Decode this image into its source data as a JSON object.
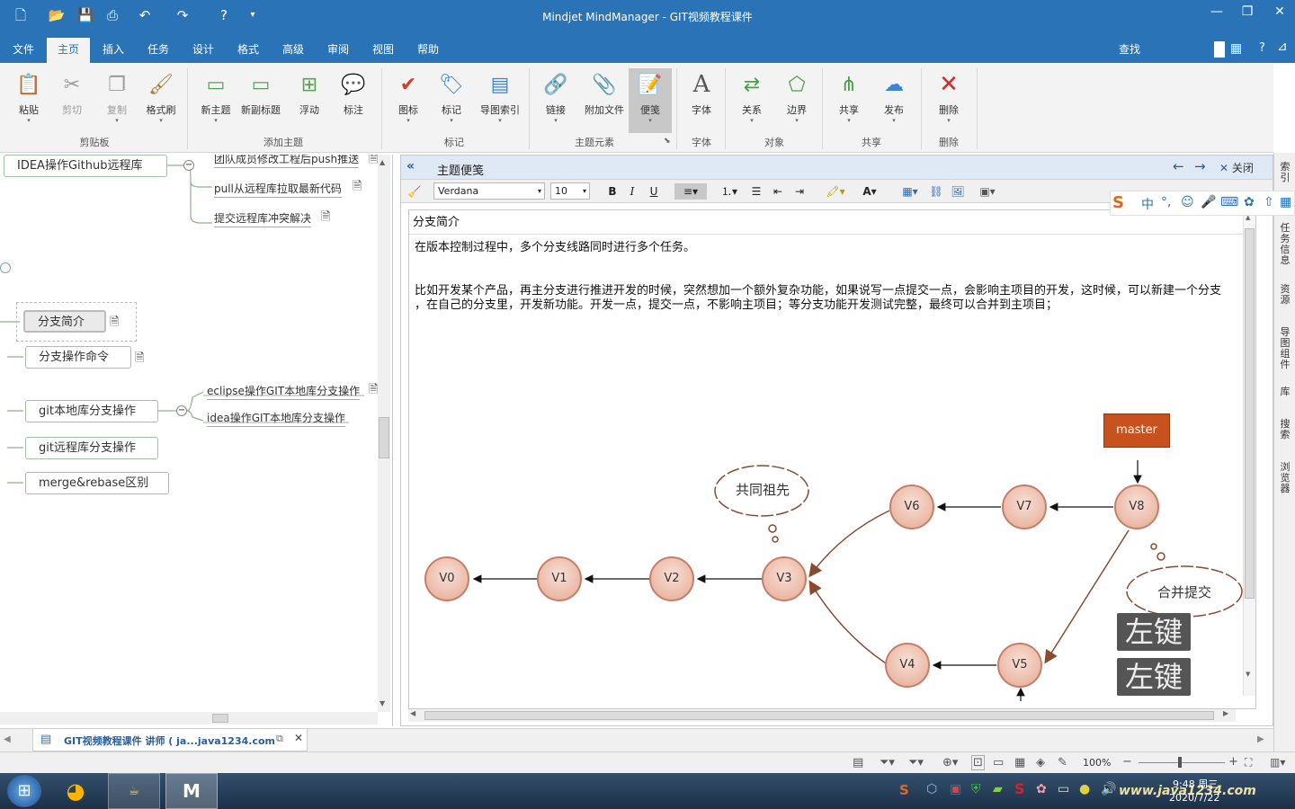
{
  "window": {
    "title": "Mindjet MindManager - GIT视频教程课件"
  },
  "menu": {
    "tabs": [
      "文件",
      "主页",
      "插入",
      "任务",
      "设计",
      "格式",
      "高级",
      "审阅",
      "视图",
      "帮助"
    ],
    "active": "主页",
    "search_label": "查找"
  },
  "ribbon": {
    "buttons": {
      "paste": "粘贴",
      "cut": "剪切",
      "copy": "复制",
      "format_painter": "格式刷",
      "new_topic": "新主题",
      "new_subtopic": "新副标题",
      "float": "浮动",
      "callout": "标注",
      "icon": "图标",
      "tag": "标记",
      "map_index": "导图索引",
      "link": "链接",
      "attach": "附加文件",
      "notes": "便笺",
      "font": "字体",
      "relation": "关系",
      "boundary": "边界",
      "share": "共享",
      "publish": "发布",
      "delete": "删除"
    },
    "groups": {
      "clipboard": "剪贴板",
      "add_topic": "添加主题",
      "tags": "标记",
      "topic_elements": "主题元素",
      "font": "字体",
      "objects": "对象",
      "share": "共享",
      "delete": "删除"
    }
  },
  "map": {
    "topics": {
      "github": "IDEA操作Github远程库",
      "branch_intro": "分支简介",
      "branch_cmd": "分支操作命令",
      "git_local": "git本地库分支操作",
      "git_remote": "git远程库分支操作",
      "merge_rebase": "merge&rebase区别"
    },
    "subtopics": {
      "team_push": "团队成员修改工程后push推送",
      "pull": "pull从远程库拉取最新代码",
      "conflict": "提交远程库冲突解决",
      "eclipse_branch": "eclipse操作GIT本地库分支操作",
      "idea_branch": "idea操作GIT本地库分支操作"
    }
  },
  "notes": {
    "header": "主题便笺",
    "close_label": "关闭",
    "font_name": "Verdana",
    "font_size": "10",
    "topic_title": "分支简介",
    "line1": "在版本控制过程中，多个分支线路同时进行多个任务。",
    "line2": "比如开发某个产品，再主分支进行推进开发的时候，突然想加一个额外复杂功能，如果说写一点提交一点，会影响主项目的开发，这时候，可以新建一个分支",
    "line3": "，在自己的分支里，开发新功能。开发一点，提交一点，不影响主项目；等分支功能开发测试完整，最终可以合并到主项目；",
    "diagram": {
      "master_label": "master",
      "commits": [
        "V0",
        "V1",
        "V2",
        "V3",
        "V4",
        "V5",
        "V6",
        "V7",
        "V8"
      ],
      "ancestor_cloud": "共同祖先",
      "merge_cloud": "合并提交"
    },
    "overlay_keys": [
      "左键",
      "左键"
    ]
  },
  "doc_tab": {
    "label": "GIT视频教程课件 讲师 ( ja...java1234.com"
  },
  "status": {
    "zoom": "100%"
  },
  "right_panel": {
    "tabs": [
      "索引",
      "任务信息",
      "资源",
      "导图组件",
      "库",
      "搜索",
      "浏览器"
    ]
  },
  "taskbar": {
    "time": "9:48 周三",
    "date": "2020/7/22",
    "watermark": "www.java1234.com"
  },
  "colors": {
    "accent": "#2b73b7",
    "commit_fill": "#eebfae",
    "master_box": "#c8521e",
    "topic_border": "#9fc49f"
  }
}
